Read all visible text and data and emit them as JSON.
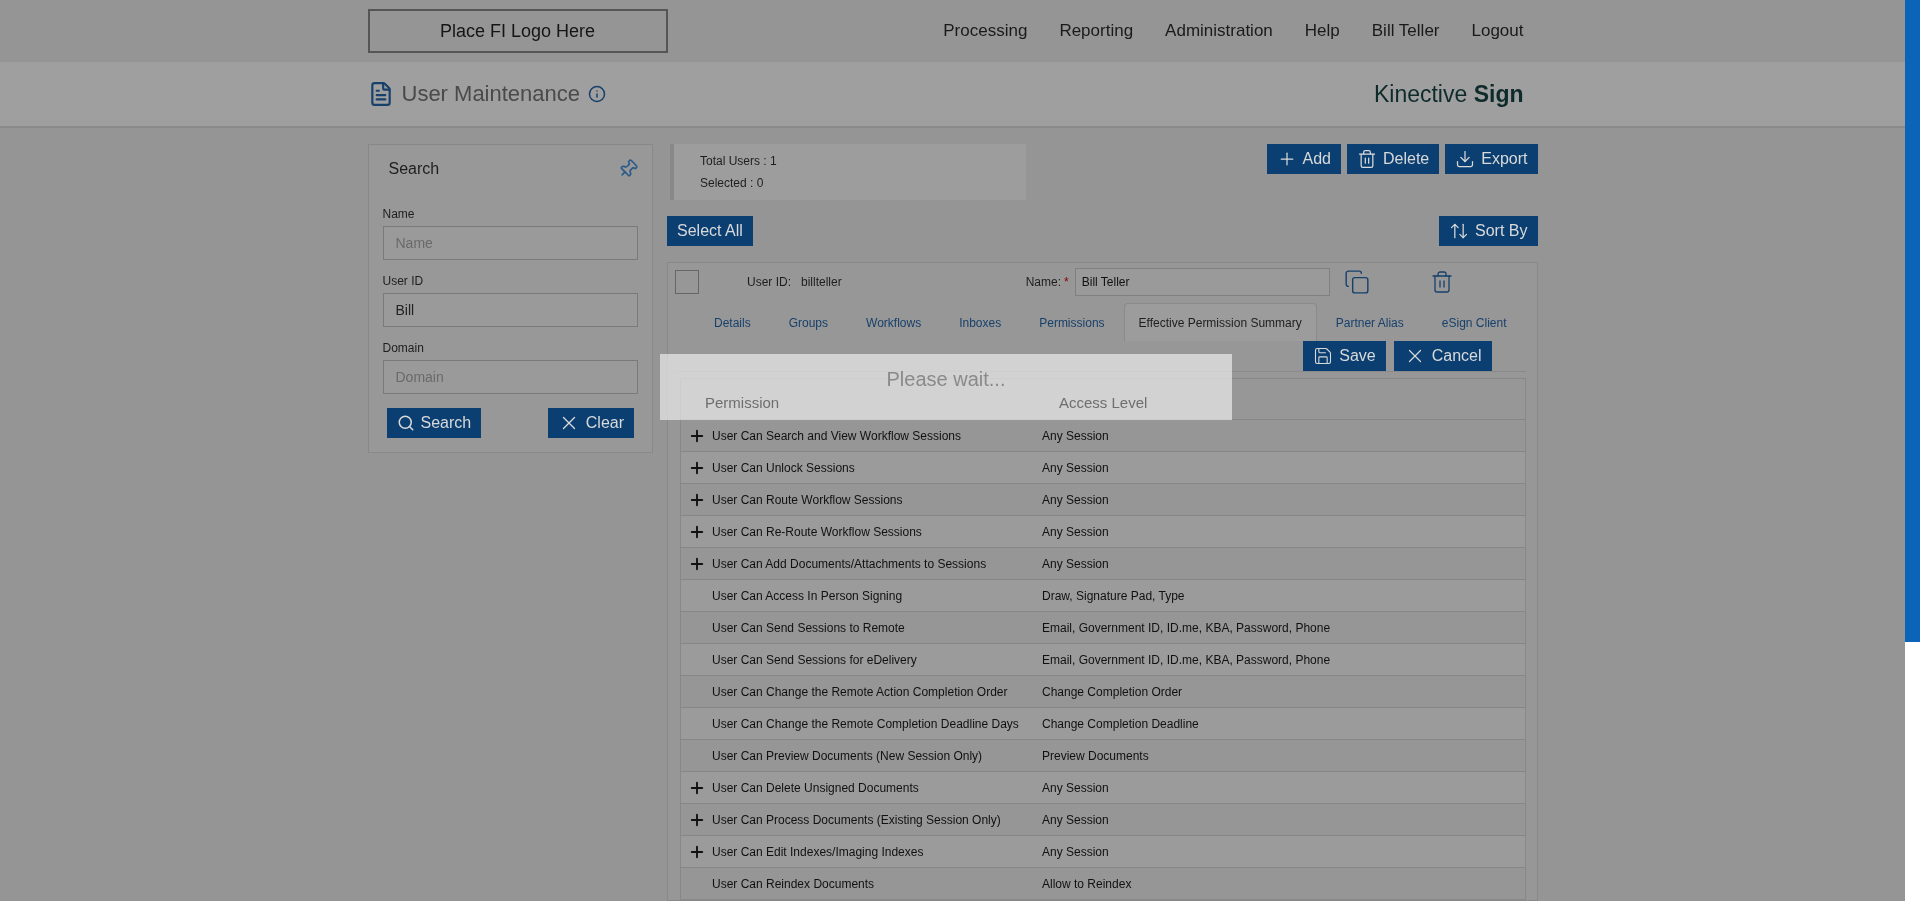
{
  "header": {
    "logo": "Place FI Logo Here",
    "nav": [
      "Processing",
      "Reporting",
      "Administration",
      "Help",
      "Bill Teller",
      "Logout"
    ]
  },
  "page": {
    "title": "User Maintenance",
    "brand_light": "Kinective",
    "brand_bold": "Sign"
  },
  "search_panel": {
    "title": "Search",
    "fields": [
      {
        "label": "Name",
        "placeholder": "Name"
      },
      {
        "label": "User ID",
        "value": "Bill"
      },
      {
        "label": "Domain",
        "placeholder": "Domain"
      }
    ],
    "buttons": [
      "Search",
      "Clear"
    ]
  },
  "stats": [
    "Total Users : 1",
    "Selected : 0"
  ],
  "toolbar": {
    "actions": [
      "Add",
      "Delete",
      "Export"
    ],
    "select_all": "Select All",
    "sort": "Sort By"
  },
  "user": {
    "checked": false,
    "user_id_label": "User ID:",
    "user_id": "billteller",
    "name_label": "Name:",
    "required_mark": "*",
    "name": "Bill Teller",
    "tabs": [
      {
        "label": "Details",
        "selected": false
      },
      {
        "label": "Groups",
        "selected": false
      },
      {
        "label": "Workflows",
        "selected": false
      },
      {
        "label": "Inboxes",
        "selected": false
      },
      {
        "label": "Permissions",
        "selected": false
      },
      {
        "label": "Effective Permission Summary",
        "selected": true
      },
      {
        "label": "Partner Alias",
        "selected": false
      },
      {
        "label": "eSign Client",
        "selected": false
      }
    ],
    "form_buttons": [
      "Save",
      "Cancel"
    ],
    "table": {
      "columns": [
        "Permission",
        "Access Level"
      ],
      "rows": [
        {
          "permission": "User Can Search and View Workflow Sessions",
          "access": "Any Session",
          "expandable": true
        },
        {
          "permission": "User Can Unlock Sessions",
          "access": "Any Session",
          "expandable": true
        },
        {
          "permission": "User Can Route Workflow Sessions",
          "access": "Any Session",
          "expandable": true
        },
        {
          "permission": "User Can Re-Route Workflow Sessions",
          "access": "Any Session",
          "expandable": true
        },
        {
          "permission": "User Can Add Documents/Attachments to Sessions",
          "access": "Any Session",
          "expandable": true
        },
        {
          "permission": "User Can Access In Person Signing",
          "access": "Draw, Signature Pad, Type",
          "expandable": false
        },
        {
          "permission": "User Can Send Sessions to Remote",
          "access": "Email, Government ID, ID.me, KBA, Password, Phone",
          "expandable": false
        },
        {
          "permission": "User Can Send Sessions for eDelivery",
          "access": "Email, Government ID, ID.me, KBA, Password, Phone",
          "expandable": false
        },
        {
          "permission": "User Can Change the Remote Action Completion Order",
          "access": "Change Completion Order",
          "expandable": false
        },
        {
          "permission": "User Can Change the Remote Completion Deadline Days",
          "access": "Change Completion Deadline",
          "expandable": false
        },
        {
          "permission": "User Can Preview Documents (New Session Only)",
          "access": "Preview Documents",
          "expandable": false
        },
        {
          "permission": "User Can Delete Unsigned Documents",
          "access": "Any Session",
          "expandable": true
        },
        {
          "permission": "User Can Process Documents (Existing Session Only)",
          "access": "Any Session",
          "expandable": true
        },
        {
          "permission": "User Can Edit Indexes/Imaging Indexes",
          "access": "Any Session",
          "expandable": true
        },
        {
          "permission": "User Can Reindex Documents",
          "access": "Allow to Reindex",
          "expandable": false
        }
      ]
    }
  },
  "loading": "Please wait..."
}
